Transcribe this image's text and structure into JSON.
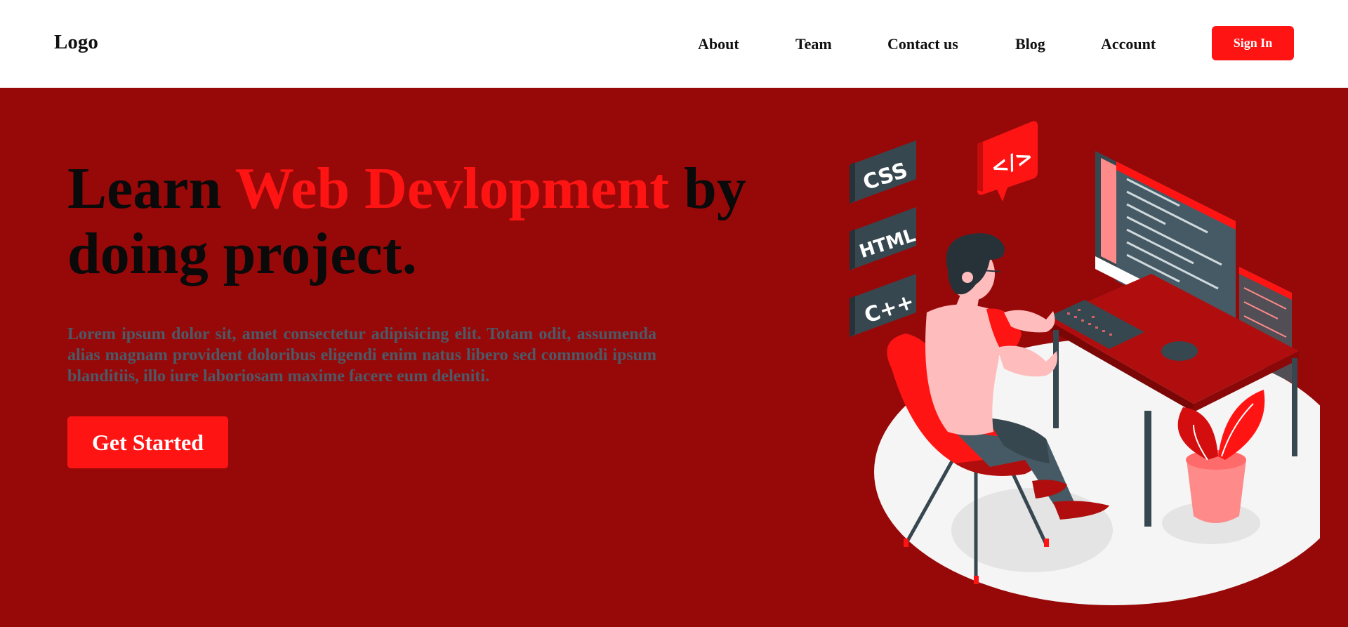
{
  "header": {
    "logo": "Logo",
    "nav": [
      {
        "label": "About",
        "name": "nav-about"
      },
      {
        "label": "Team",
        "name": "nav-team"
      },
      {
        "label": "Contact us",
        "name": "nav-contact-us"
      },
      {
        "label": "Blog",
        "name": "nav-blog"
      },
      {
        "label": "Account",
        "name": "nav-account"
      }
    ],
    "signin_label": "Sign In"
  },
  "hero": {
    "headline_pre": "Learn ",
    "headline_accent": "Web Devlopment",
    "headline_post": " by doing project.",
    "lead": "Lorem ipsum dolor sit, amet consectetur adipisicing elit. Totam odit, assumenda alias magnam provident doloribus eligendi enim natus libero sed commodi ipsum blanditiis, illo iure laboriosam maxime facere eum deleniti.",
    "cta_label": "Get Started"
  },
  "illustration": {
    "badges": [
      "CSS",
      "HTML",
      "C++"
    ],
    "code_tag": "</>"
  },
  "colors": {
    "accent": "#ff1414",
    "hero_bg": "#970909",
    "text_muted": "#4b5a66"
  }
}
